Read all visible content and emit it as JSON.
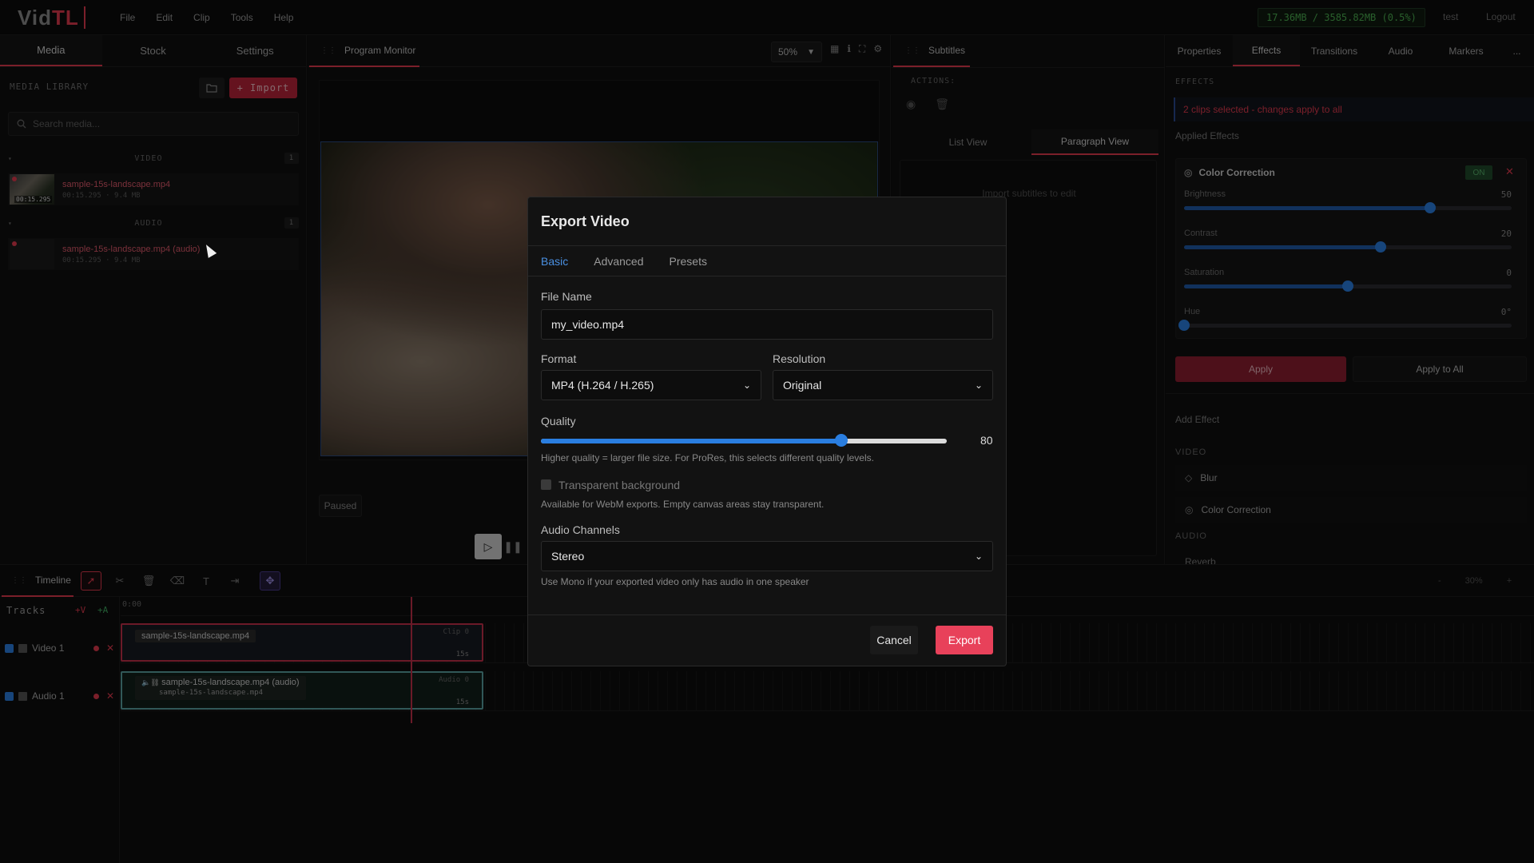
{
  "app": {
    "logo_a": "Vid",
    "logo_b": "TL",
    "memory": "17.36MB / 3585.82MB (0.5%)",
    "user": "test",
    "logout": "Logout"
  },
  "menu": [
    "File",
    "Edit",
    "Clip",
    "Tools",
    "Help"
  ],
  "left": {
    "tabs": [
      "Media",
      "Stock",
      "Settings"
    ],
    "library_title": "MEDIA LIBRARY",
    "import_label": "+ Import",
    "search_placeholder": "Search media...",
    "groups": [
      {
        "label": "VIDEO",
        "count": "1",
        "items": [
          {
            "name": "sample-15s-landscape.mp4",
            "meta": "00:15.295 · 9.4 MB",
            "thumb_tc": "00:15.295"
          }
        ]
      },
      {
        "label": "AUDIO",
        "count": "1",
        "items": [
          {
            "name": "sample-15s-landscape.mp4 (audio)",
            "meta": "00:15.295 · 9.4 MB"
          }
        ]
      }
    ]
  },
  "monitor": {
    "tab": "Program Monitor",
    "zoom": "50%",
    "status": "Paused"
  },
  "subtitles": {
    "tab": "Subtitles",
    "actions": "ACTIONS:",
    "views": [
      "List View",
      "Paragraph View"
    ],
    "placeholder": "Import subtitles to edit"
  },
  "right": {
    "tabs": [
      "Properties",
      "Effects",
      "Transitions",
      "Audio",
      "Markers",
      "..."
    ],
    "effects_title": "EFFECTS",
    "selection_note": "2 clips selected - changes apply to all",
    "applied_title": "Applied Effects",
    "cc": {
      "title": "Color Correction",
      "on": "ON",
      "sliders": [
        {
          "label": "Brightness",
          "value": "50",
          "fraction": 0.75
        },
        {
          "label": "Contrast",
          "value": "20",
          "fraction": 0.6
        },
        {
          "label": "Saturation",
          "value": "0",
          "fraction": 0.5
        },
        {
          "label": "Hue",
          "value": "0°",
          "fraction": 0.0
        }
      ]
    },
    "apply": "Apply",
    "apply_all": "Apply to All",
    "add_effect": "Add Effect",
    "video_hdr": "VIDEO",
    "video_effects": [
      "Blur",
      "Color Correction"
    ],
    "audio_hdr": "AUDIO",
    "audio_effects": [
      "Reverb"
    ]
  },
  "timeline": {
    "tab": "Timeline",
    "tracks_title": "Tracks",
    "add_v": "+V",
    "add_a": "+A",
    "ruler_start": "0:00",
    "zoom_minus": "-",
    "zoom": "30%",
    "zoom_plus": "+",
    "tracks": [
      {
        "name": "Video 1",
        "clip": "sample-15s-landscape.mp4",
        "corner": "Clip 0",
        "dur": "15s"
      },
      {
        "name": "Audio 1",
        "clip": "sample-15s-landscape.mp4 (audio)",
        "clip_sub": "sample-15s-landscape.mp4",
        "corner": "Audio 0",
        "dur": "15s"
      }
    ]
  },
  "modal": {
    "title": "Export Video",
    "tabs": [
      "Basic",
      "Advanced",
      "Presets"
    ],
    "file_name_label": "File Name",
    "file_name": "my_video.mp4",
    "format_label": "Format",
    "format": "MP4 (H.264 / H.265)",
    "resolution_label": "Resolution",
    "resolution": "Original",
    "quality_label": "Quality",
    "quality": "80",
    "quality_fraction": 0.74,
    "quality_hint": "Higher quality = larger file size. For ProRes, this selects different quality levels.",
    "transparent_label": "Transparent background",
    "transparent_hint": "Available for WebM exports. Empty canvas areas stay transparent.",
    "audio_label": "Audio Channels",
    "audio": "Stereo",
    "audio_hint": "Use Mono if your exported video only has audio in one speaker",
    "cancel": "Cancel",
    "export": "Export"
  }
}
